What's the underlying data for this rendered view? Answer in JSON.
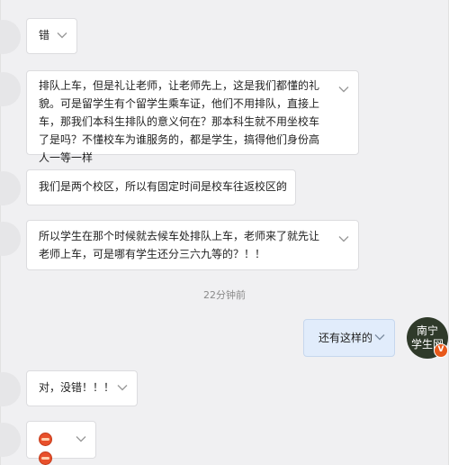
{
  "messages": [
    {
      "side": "left",
      "text": "错"
    },
    {
      "side": "left",
      "text": "排队上车，但是礼让老师，让老师先上，这是我们都懂的礼貌。可是留学生有个留学生乘车证，他们不用排队，直接上车，那我们本科生排队的意义何在？那本科生就不用坐校车了是吗？不懂校车为谁服务的，都是学生，搞得他们身份高人一等一样"
    },
    {
      "side": "left",
      "text": "我们是两个校区，所以有固定时间是校车往返校区的"
    },
    {
      "side": "left",
      "text": "所以学生在那个时候就去候车处排队上车，老师来了就先让老师上车，可是哪有学生还分三六九等的？！！"
    },
    {
      "side": "right",
      "text": "还有这样的"
    },
    {
      "side": "left",
      "text": "对，没错！！！"
    },
    {
      "side": "left",
      "text": "",
      "emoji": [
        "grimace-emoji",
        "grimace-emoji"
      ]
    }
  ],
  "timestamp": "22分钟前",
  "my_avatar": {
    "line1": "南宁",
    "line2": "学生网"
  },
  "colors": {
    "background": "#f0f0f2",
    "bubble_left": "#ffffff",
    "bubble_right": "#e1ecfb",
    "verified_badge": "#e8591b"
  },
  "icons": {
    "bubble_menu": "chevron-down-icon",
    "badge": "verified-v-icon"
  }
}
